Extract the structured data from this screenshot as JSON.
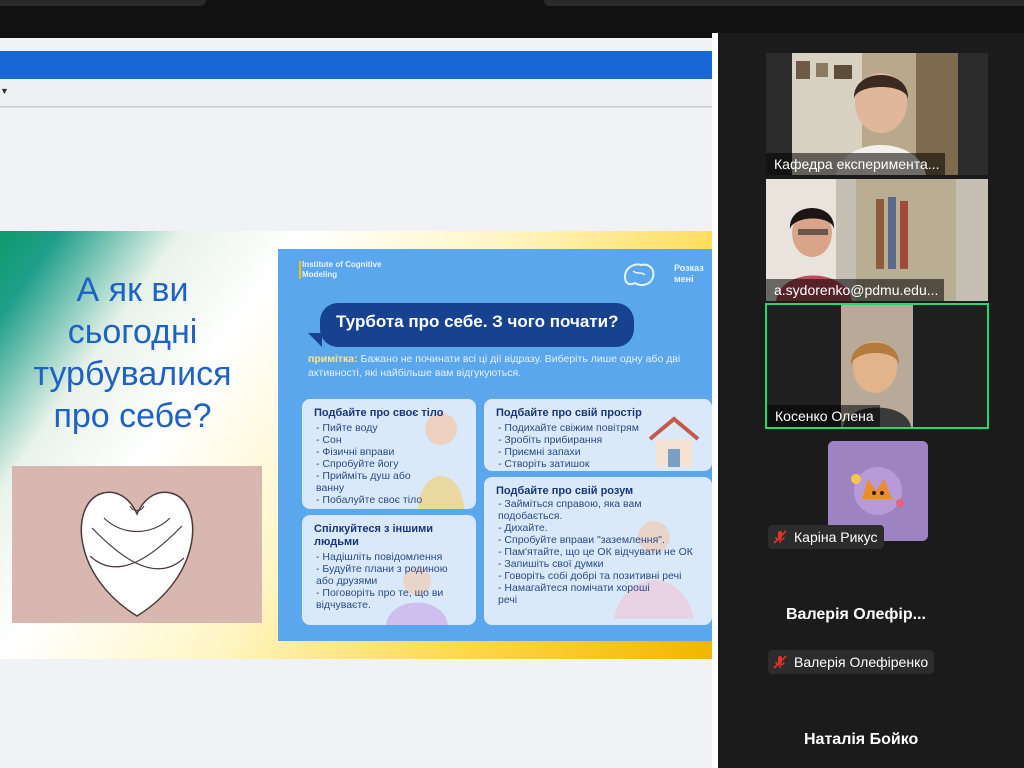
{
  "slide": {
    "question": "А як ви сьогодні турбувалися про себе?",
    "card": {
      "institute": "Institute of Cognitive Modeling",
      "right_word": "Розказ мені",
      "title": "Турбота про себе. З чого почати?",
      "note_label": "примітка:",
      "note_text": " Бажано не починати всі ці дії відразу. Виберіть лише одну або дві активності, які найбільше вам відгукуються.",
      "boxes": {
        "body": {
          "title": "Подбайте про своє тіло",
          "items": [
            "Пийте воду",
            "Сон",
            "Фізичні вправи",
            "Спробуйте йогу",
            "Прийміть душ або ванну",
            "Побалуйте своє тіло"
          ]
        },
        "space": {
          "title": "Подбайте про свій простір",
          "items": [
            "Подихайте свіжим повітрям",
            "Зробіть прибирання",
            "Приємні запахи",
            "Створіть затишок"
          ]
        },
        "people": {
          "title": "Спілкуйтеся з іншими людьми",
          "items": [
            "Надішліть повідомлення",
            "Будуйте плани з родиною або друзями",
            "Поговоріть про те, що ви відчуваєте."
          ]
        },
        "mind": {
          "title": "Подбайте про свій розум",
          "items": [
            "Займіться справою, яка вам подобається.",
            "Дихайте.",
            "Спробуйте вправи \"заземлення\".",
            "Пам'ятайте, що це ОК відчувати не ОК",
            "Запишіть свої думки",
            "Говоріть собі добрі та позитивні речі",
            "Намагайтеся помічати хороші речі"
          ]
        }
      }
    }
  },
  "participants": {
    "tiles": [
      {
        "name": "Кафедра експериментальної…",
        "display": "Кафедра експеримента..."
      },
      {
        "name": "a.sydorenko@pdmu.edu…",
        "display": "a.sydorenko@pdmu.edu..."
      },
      {
        "name": "Косенко Олена",
        "display": "Косенко Олена"
      }
    ],
    "karina": {
      "name": "Каріна Рикус"
    },
    "valeria": {
      "big": "Валерія Олефір...",
      "small": "Валерія Олефіренко"
    },
    "natalia": {
      "big": "Наталія Бойко"
    },
    "colors": {
      "active_border": "#23d96f",
      "mute_icon": "#e0332a"
    }
  }
}
